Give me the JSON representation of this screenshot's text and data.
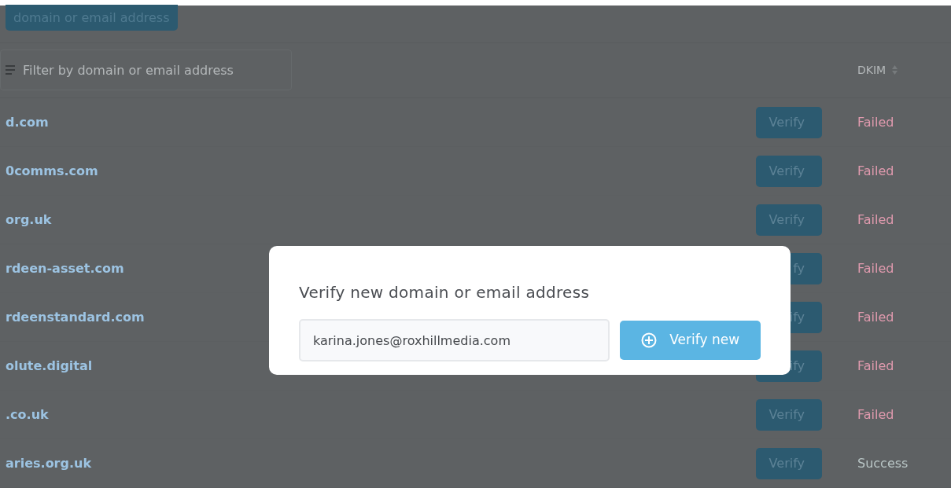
{
  "header_button": {
    "label": "domain or email address"
  },
  "filter": {
    "placeholder": "Filter by domain or email address"
  },
  "table": {
    "columns": [
      {
        "label": "DKIM"
      }
    ],
    "rows": [
      {
        "domain": "d.com",
        "action": "Verify",
        "dkim": "Failed",
        "kind": "failed"
      },
      {
        "domain": "0comms.com",
        "action": "Verify",
        "dkim": "Failed",
        "kind": "failed"
      },
      {
        "domain": "org.uk",
        "action": "Verify",
        "dkim": "Failed",
        "kind": "failed"
      },
      {
        "domain": "rdeen-asset.com",
        "action": "fy",
        "dkim": "Failed",
        "kind": "failed"
      },
      {
        "domain": "rdeenstandard.com",
        "action": "ify",
        "dkim": "Failed",
        "kind": "failed"
      },
      {
        "domain": "olute.digital",
        "action": "ify",
        "dkim": "Failed",
        "kind": "failed"
      },
      {
        "domain": ".co.uk",
        "action": "Verify",
        "dkim": "Failed",
        "kind": "failed"
      },
      {
        "domain": "aries.org.uk",
        "action": "Verify",
        "dkim": "Success",
        "kind": "success"
      }
    ]
  },
  "dialog": {
    "title": "Verify new domain or email address",
    "input_value": "karina.jones@roxhillmedia.com",
    "button": "Verify new"
  }
}
